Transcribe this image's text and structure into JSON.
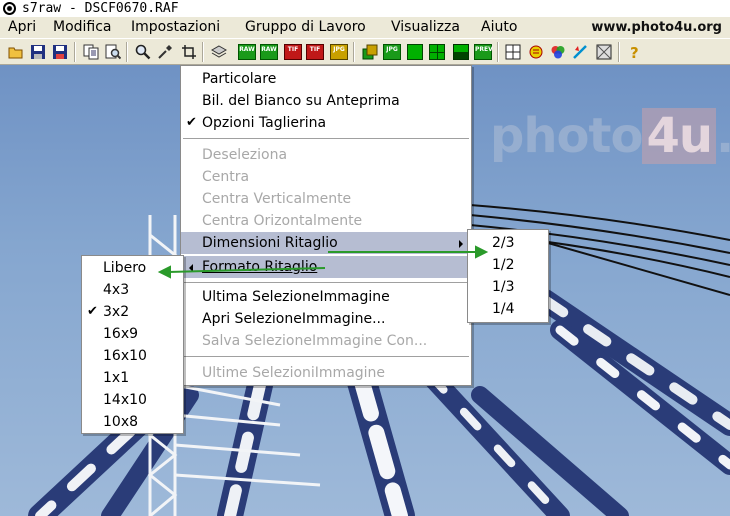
{
  "window": {
    "title": "s7raw - DSCF0670.RAF"
  },
  "menubar": {
    "items": [
      "Apri",
      "Modifica",
      "Impostazioni",
      "Gruppo di Lavoro",
      "Visualizza",
      "Aiuto"
    ],
    "site": "www.photo4u.org"
  },
  "toolbar": {
    "badges": {
      "raw": "RAW",
      "tif": "TIF",
      "jpg": "JPG",
      "jpg_s": "JPG",
      "prev": "PREV"
    }
  },
  "watermark": {
    "pre": "photo",
    "box": "4u",
    "post": ".it",
    "reg": "®"
  },
  "crop_menu": {
    "items": [
      "Particolare",
      "Bil. del Bianco su Anteprima",
      "Opzioni Taglierina",
      "Deseleziona",
      "Centra",
      "Centra Verticalmente",
      "Centra Orizontalmente",
      "Dimensioni Ritaglio",
      "Formato Ritaglio",
      "Ultima SelezioneImmagine",
      "Apri SelezioneImmagine...",
      "Salva SelezioneImmagine Con...",
      "Ultime SelezioniImmagine"
    ],
    "check": "✔"
  },
  "size_menu": {
    "items": [
      "2/3",
      "1/2",
      "1/3",
      "1/4"
    ]
  },
  "format_menu": {
    "items": [
      "Libero",
      "4x3",
      "3x2",
      "16x9",
      "16x10",
      "1x1",
      "14x10",
      "10x8"
    ],
    "checked": "3x2"
  },
  "colors": {
    "menu_highlight": "#b6bdd2",
    "annotation_arrow": "#2a9a2a",
    "sky": "#85a6cf"
  },
  "toolbar_icons": [
    "open-folder-icon",
    "save-icon",
    "save-as-icon",
    "copy-icon",
    "find-icon",
    "zoom-icon",
    "eyedropper-icon",
    "crop-icon",
    "layers-icon",
    "raw-icon",
    "raw-icon",
    "tif-icon",
    "tif-icon",
    "jpg-icon",
    "batch-icon",
    "jpg-small-icon",
    "green-square-icon",
    "green-grid-icon",
    "green-half-icon",
    "preview-icon",
    "grid-icon",
    "badge-icon",
    "rgb-icon",
    "gradient-icon",
    "frame-icon",
    "help-icon"
  ]
}
